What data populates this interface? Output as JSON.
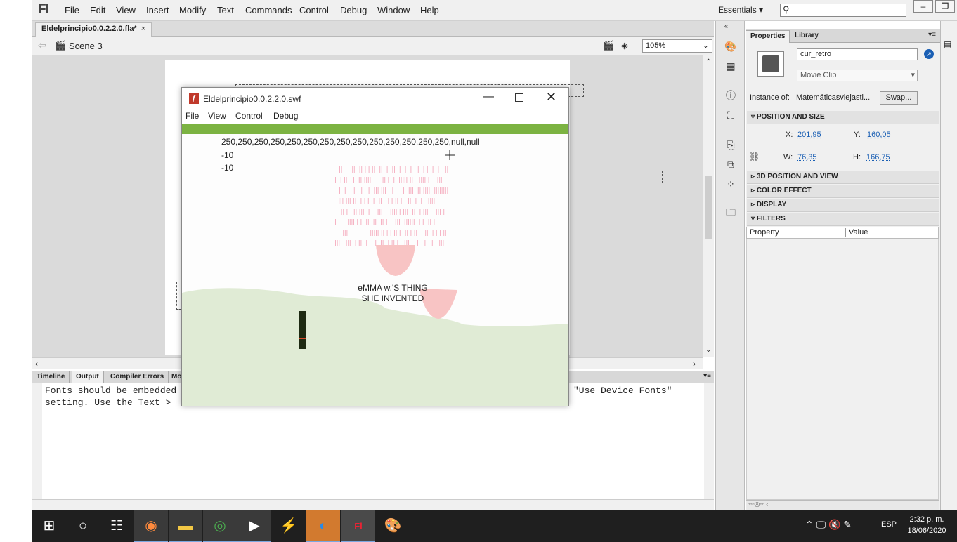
{
  "app": {
    "logo": "Fl"
  },
  "menu": [
    "File",
    "Edit",
    "View",
    "Insert",
    "Modify",
    "Text",
    "Commands",
    "Control",
    "Debug",
    "Window",
    "Help"
  ],
  "workspace": {
    "label": "Essentials ▾"
  },
  "document": {
    "tab": "Eldelprincipio0.0.2.2.0.fla*",
    "close": "×",
    "scene": "Scene 3",
    "zoom": "105%"
  },
  "output": {
    "tabs": [
      "Timeline",
      "Output",
      "Compiler Errors",
      "Mo"
    ],
    "selected": "Output",
    "line1": "Fonts should be embedded",
    "line1_right": "\"Use Device Fonts\"",
    "line2": "setting. Use the Text > "
  },
  "properties": {
    "tabs": [
      "Properties",
      "Library"
    ],
    "instance_name": "cur_retro",
    "symbol_type": "Movie Clip",
    "instance_of_label": "Instance of:",
    "instance_of_value": "Matemáticasviejasti...",
    "swap_label": "Swap...",
    "sections": {
      "position": "POSITION AND SIZE",
      "pos3d": "3D POSITION AND VIEW",
      "color": "COLOR EFFECT",
      "display": "DISPLAY",
      "filters": "FILTERS"
    },
    "x_label": "X:",
    "x": "201,95",
    "y_label": "Y:",
    "y": "160,05",
    "w_label": "W:",
    "w": "76,35",
    "h_label": "H:",
    "h": "166,75",
    "filter_cols": [
      "Property",
      "Value"
    ]
  },
  "swf": {
    "title": "Eldelprincipio0.0.2.2.0.swf",
    "menu": [
      "File",
      "View",
      "Control",
      "Debug"
    ],
    "trace1": "250,250,250,250,250,250,250,250,250,250,250,250,250,250,null,null",
    "trace2": "-10",
    "trace3": "-10",
    "caption1": "eMMA w.'S THING",
    "caption2": "SHE INVENTED",
    "colors": {
      "green_bar": "#7cb342",
      "ground": "#e0ebd5",
      "pink": "#f6b3c4",
      "bowl": "#f8c4c4",
      "pole": "#1e2a12"
    }
  },
  "taskbar": {
    "lang": "ESP",
    "time": "2:32 p. m.",
    "date": "18/06/2020"
  }
}
